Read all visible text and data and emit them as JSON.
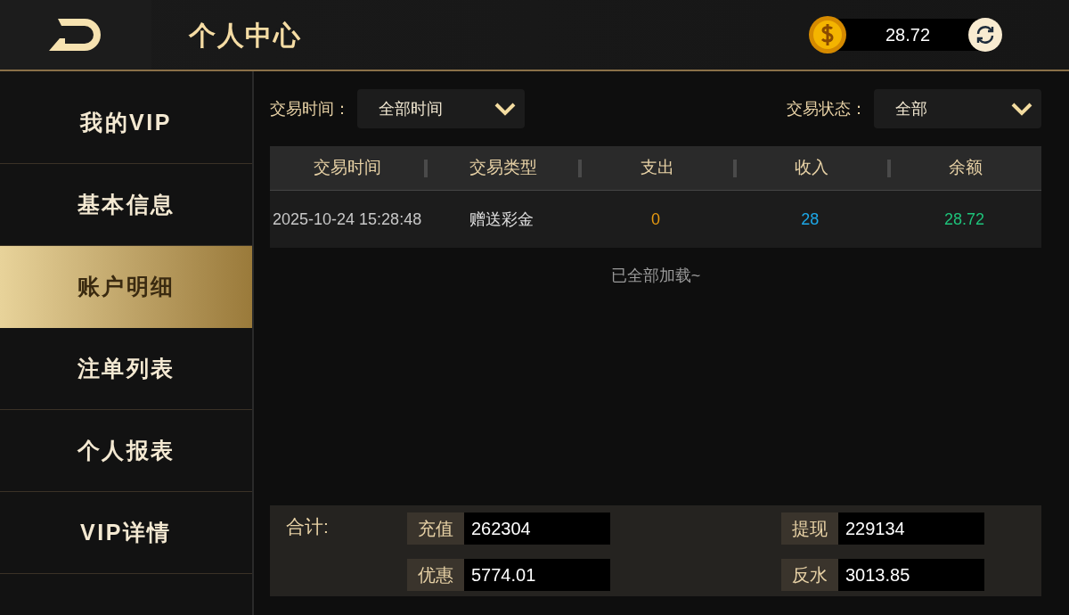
{
  "header": {
    "title": "个人中心",
    "balance": "28.72"
  },
  "sidebar": {
    "items": [
      {
        "label": "我的VIP",
        "selected": false
      },
      {
        "label": "基本信息",
        "selected": false
      },
      {
        "label": "账户明细",
        "selected": true
      },
      {
        "label": "注单列表",
        "selected": false
      },
      {
        "label": "个人报表",
        "selected": false
      },
      {
        "label": "VIP详情",
        "selected": false
      }
    ]
  },
  "filters": [
    {
      "label": "交易时间：",
      "value": "全部时间"
    },
    {
      "label": "交易状态：",
      "value": "全部"
    }
  ],
  "table": {
    "columns": [
      "交易时间",
      "交易类型",
      "支出",
      "收入",
      "余额"
    ],
    "rows": [
      {
        "cells": [
          "2025-10-24 15:28:48",
          "赠送彩金",
          "0",
          "28",
          "28.72"
        ]
      }
    ]
  },
  "load_status": "已全部加载~",
  "summary": {
    "label": "合计:",
    "items": [
      {
        "label": "充值",
        "value": "262304"
      },
      {
        "label": "提现",
        "value": "229134"
      },
      {
        "label": "优惠",
        "value": "5774.01"
      },
      {
        "label": "反水",
        "value": "3013.85"
      }
    ]
  }
}
